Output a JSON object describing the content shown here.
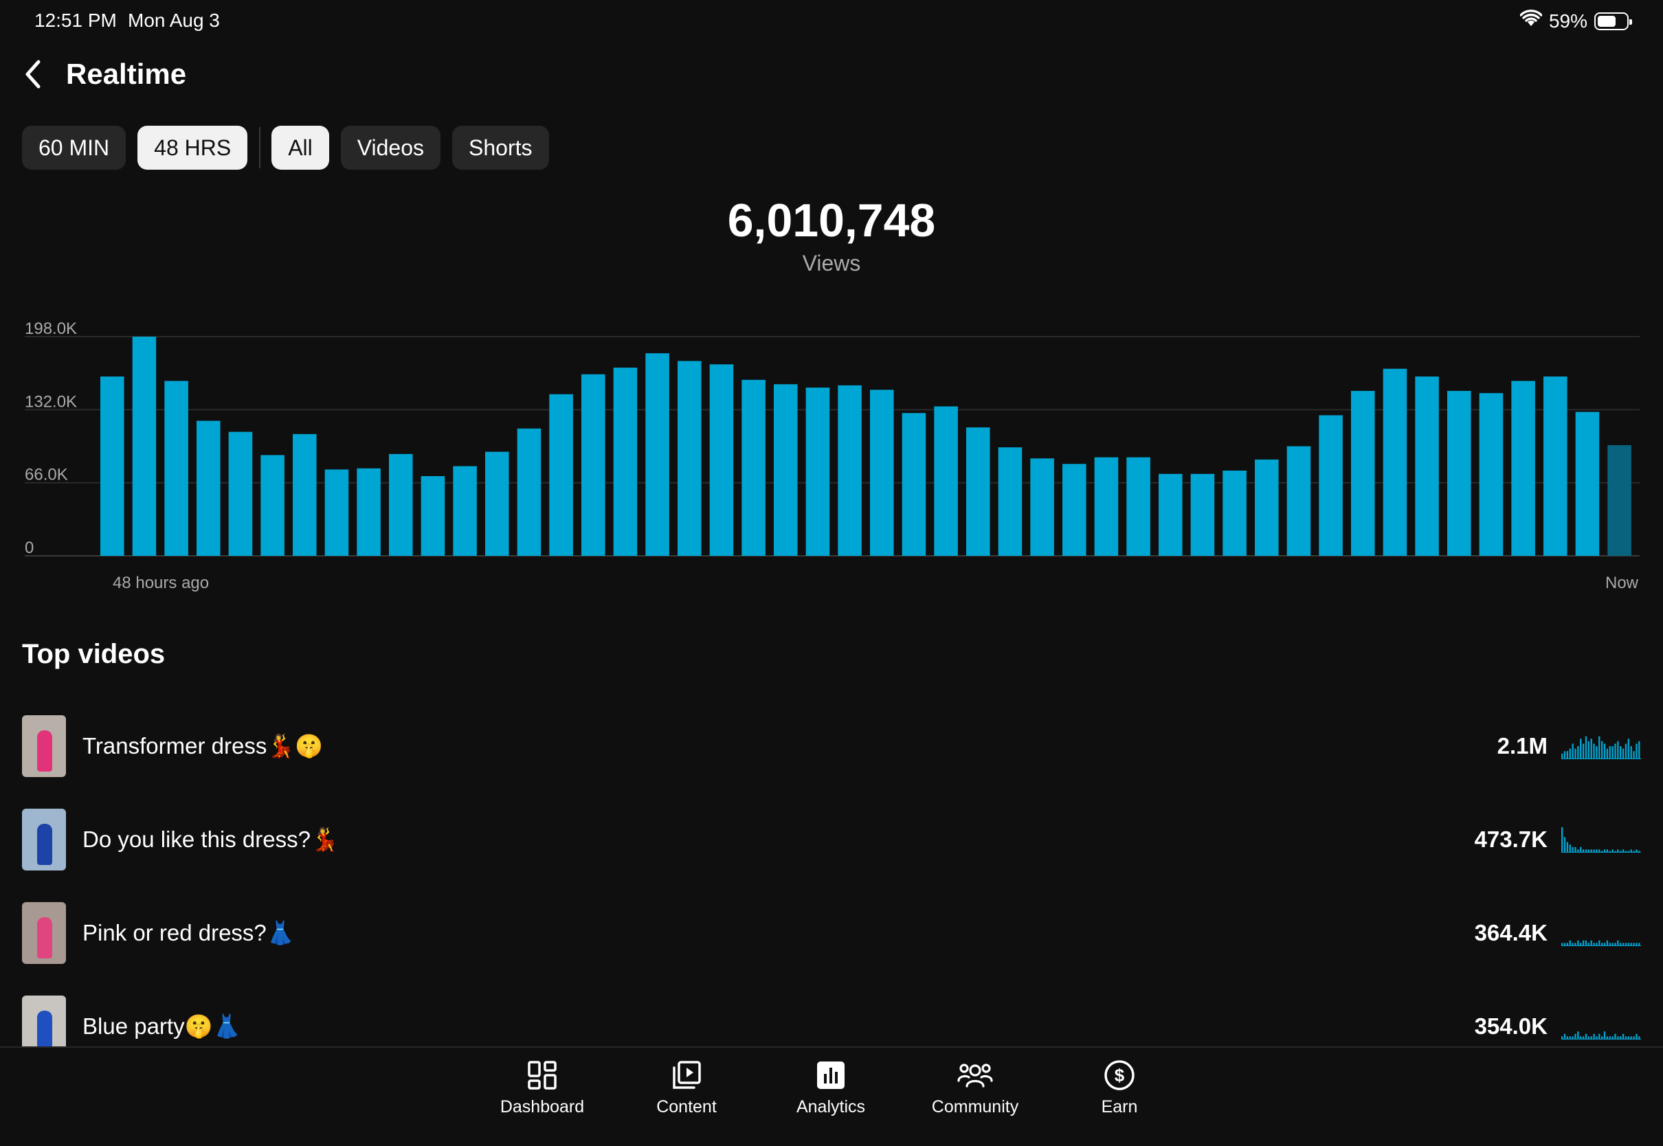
{
  "status": {
    "time": "12:51 PM",
    "date": "Mon Aug 3",
    "battery": "59%"
  },
  "header": {
    "title": "Realtime"
  },
  "filters": {
    "time_ranges": [
      {
        "label": "60 MIN",
        "active": false
      },
      {
        "label": "48 HRS",
        "active": true
      }
    ],
    "content_types": [
      {
        "label": "All",
        "active": true
      },
      {
        "label": "Videos",
        "active": false
      },
      {
        "label": "Shorts",
        "active": false
      }
    ]
  },
  "summary": {
    "value": "6,010,748",
    "label": "Views"
  },
  "chart_data": {
    "type": "bar",
    "y_ticks": [
      "198.0K",
      "132.0K",
      "66.0K",
      "0"
    ],
    "ylim": [
      0,
      198000
    ],
    "x_start_label": "48 hours ago",
    "x_end_label": "Now",
    "bar_color": "#00a6d3",
    "partial_bar_color": "#08647e",
    "grid": true,
    "values": [
      162000,
      198000,
      158000,
      122000,
      112000,
      91000,
      110000,
      78000,
      79000,
      92000,
      72000,
      81000,
      94000,
      115000,
      146000,
      164000,
      170000,
      183000,
      176000,
      173000,
      159000,
      155000,
      152000,
      154000,
      150000,
      129000,
      135000,
      116000,
      98000,
      88000,
      83000,
      89000,
      89000,
      74000,
      74000,
      77000,
      87000,
      99000,
      127000,
      149000,
      169000,
      162000,
      149000,
      147000,
      158000,
      162000,
      130000,
      100000
    ]
  },
  "top_videos": {
    "title": "Top videos",
    "items": [
      {
        "title": "Transformer dress💃🤫",
        "views": "2.1M",
        "thumb_colors": [
          "#b8b0a8",
          "#e2337a"
        ],
        "spark": [
          2,
          3,
          3,
          4,
          6,
          4,
          5,
          8,
          6,
          9,
          7,
          8,
          6,
          5,
          9,
          7,
          6,
          4,
          5,
          5,
          6,
          7,
          5,
          4,
          6,
          8,
          5,
          3,
          6,
          7
        ]
      },
      {
        "title": "Do you like this dress?💃",
        "views": "473.7K",
        "thumb_colors": [
          "#9fb6cf",
          "#1e43a8"
        ],
        "spark": [
          10,
          6,
          4,
          3,
          2,
          2,
          1,
          2,
          1,
          1,
          1,
          1,
          1,
          1,
          1,
          0,
          1,
          1,
          0,
          1,
          0,
          1,
          0,
          1,
          0,
          0,
          1,
          0,
          1,
          0
        ]
      },
      {
        "title": "Pink or red dress?👗",
        "views": "364.4K",
        "thumb_colors": [
          "#a89a92",
          "#e0457f"
        ],
        "spark": [
          1,
          1,
          1,
          2,
          1,
          1,
          2,
          1,
          2,
          2,
          1,
          2,
          1,
          1,
          2,
          1,
          1,
          2,
          1,
          1,
          1,
          2,
          1,
          1,
          1,
          1,
          1,
          1,
          1,
          1
        ]
      },
      {
        "title": "Blue party🤫👗",
        "views": "354.0K",
        "thumb_colors": [
          "#c8c4c0",
          "#2050c0"
        ],
        "spark": [
          1,
          2,
          1,
          1,
          1,
          2,
          3,
          1,
          1,
          2,
          1,
          1,
          2,
          1,
          2,
          1,
          3,
          1,
          1,
          1,
          2,
          1,
          1,
          2,
          1,
          1,
          1,
          1,
          2,
          1
        ]
      }
    ]
  },
  "nav": [
    {
      "label": "Dashboard",
      "icon": "dashboard-icon"
    },
    {
      "label": "Content",
      "icon": "content-icon"
    },
    {
      "label": "Analytics",
      "icon": "analytics-icon"
    },
    {
      "label": "Community",
      "icon": "community-icon"
    },
    {
      "label": "Earn",
      "icon": "earn-icon"
    }
  ]
}
